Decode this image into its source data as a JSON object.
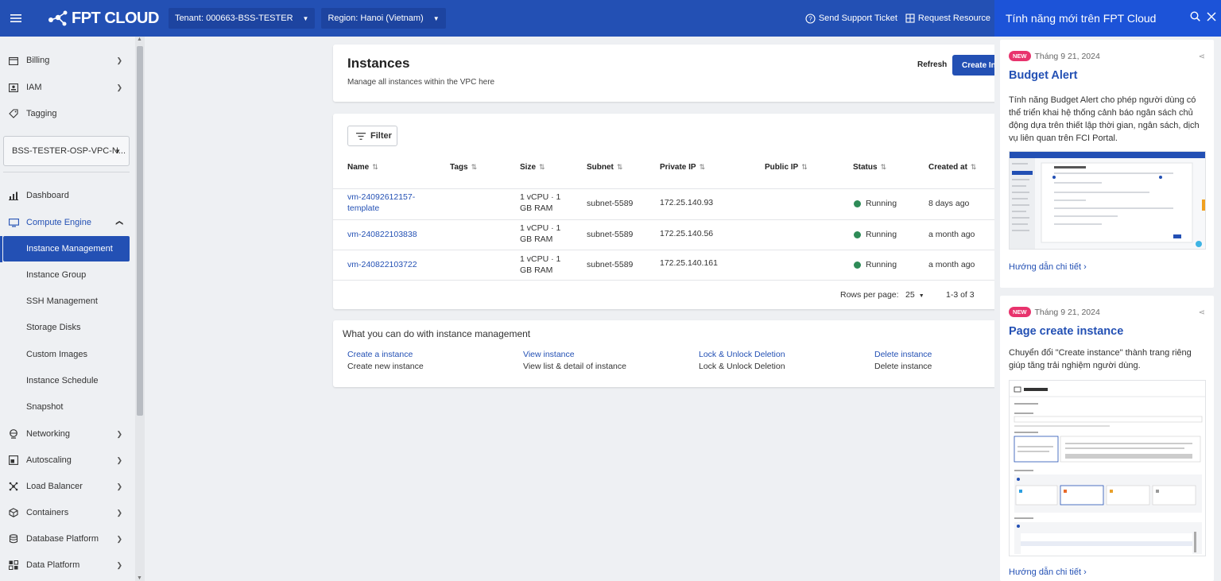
{
  "header": {
    "brand": "FPT CLOUD",
    "tenant": "Tenant: 000663-BSS-TESTER",
    "region": "Region: Hanoi (Vietnam)",
    "support": "Send Support Ticket",
    "request": "Request Resource"
  },
  "sidebar": {
    "top_items": [
      {
        "label": "Billing",
        "icon": "billing-icon"
      },
      {
        "label": "IAM",
        "icon": "iam-icon"
      },
      {
        "label": "Tagging",
        "icon": "tag-icon"
      }
    ],
    "project": "BSS-TESTER-OSP-VPC-N...",
    "dashboard": "Dashboard",
    "compute_engine": "Compute Engine",
    "compute_sub": [
      "Instance Management",
      "Instance Group",
      "SSH Management",
      "Storage Disks",
      "Custom Images",
      "Instance Schedule",
      "Snapshot"
    ],
    "bottom_items": [
      "Networking",
      "Autoscaling",
      "Load Balancer",
      "Containers",
      "Database Platform",
      "Data Platform"
    ]
  },
  "page": {
    "title": "Instances",
    "subtitle": "Manage all instances within the VPC here",
    "refresh": "Refresh",
    "create": "Create In"
  },
  "table": {
    "filter": "Filter",
    "columns": [
      "Name",
      "Tags",
      "Size",
      "Subnet",
      "Private IP",
      "Public IP",
      "Status",
      "Created at"
    ],
    "rows": [
      {
        "name_line1": "vm-24092612157-",
        "name_line2": "template",
        "size_line1": "1 vCPU · 1",
        "size_line2": "GB RAM",
        "subnet": "subnet-5589",
        "private_ip": "172.25.140.93",
        "status": "Running",
        "created": "8 days ago"
      },
      {
        "name_line1": "vm-240822103838",
        "name_line2": "",
        "size_line1": "1 vCPU · 1",
        "size_line2": "GB RAM",
        "subnet": "subnet-5589",
        "private_ip": "172.25.140.56",
        "status": "Running",
        "created": "a month ago"
      },
      {
        "name_line1": "vm-240822103722",
        "name_line2": "",
        "size_line1": "1 vCPU · 1",
        "size_line2": "GB RAM",
        "subnet": "subnet-5589",
        "private_ip": "172.25.140.161",
        "status": "Running",
        "created": "a month ago"
      }
    ],
    "rows_per_page_label": "Rows per page:",
    "rows_per_page": "25",
    "range": "1-3 of 3"
  },
  "actions": {
    "title": "What you can do with instance management",
    "items": [
      {
        "link": "Create a instance",
        "desc": "Create new instance"
      },
      {
        "link": "View instance",
        "desc": "View list & detail of instance"
      },
      {
        "link": "Lock & Unlock Deletion",
        "desc": "Lock & Unlock Deletion"
      },
      {
        "link": "Delete instance",
        "desc": "Delete instance"
      }
    ]
  },
  "panel": {
    "title": "Tính năng mới trên FPT Cloud",
    "news": [
      {
        "badge": "NEW",
        "date": "Tháng 9 21, 2024",
        "title": "Budget Alert",
        "body": "Tính năng Budget Alert cho phép người dùng có thể triển khai hệ thống cảnh báo ngân sách chủ động dựa trên thiết lập thời gian, ngân sách, dịch vụ liên quan trên FCI Portal.",
        "guide": "Hướng dẫn chi tiết ›"
      },
      {
        "badge": "NEW",
        "date": "Tháng 9 21, 2024",
        "title": "Page create instance",
        "body": "Chuyển đổi \"Create instance\" thành trang riêng giúp tăng trải nghiệm người dùng.",
        "guide": "Hướng dẫn chi tiết ›"
      }
    ]
  },
  "colors": {
    "brand": "#2350b4",
    "panel_header": "#1c53d8",
    "running": "#2e8b57",
    "new_badge": "#e8336d"
  }
}
